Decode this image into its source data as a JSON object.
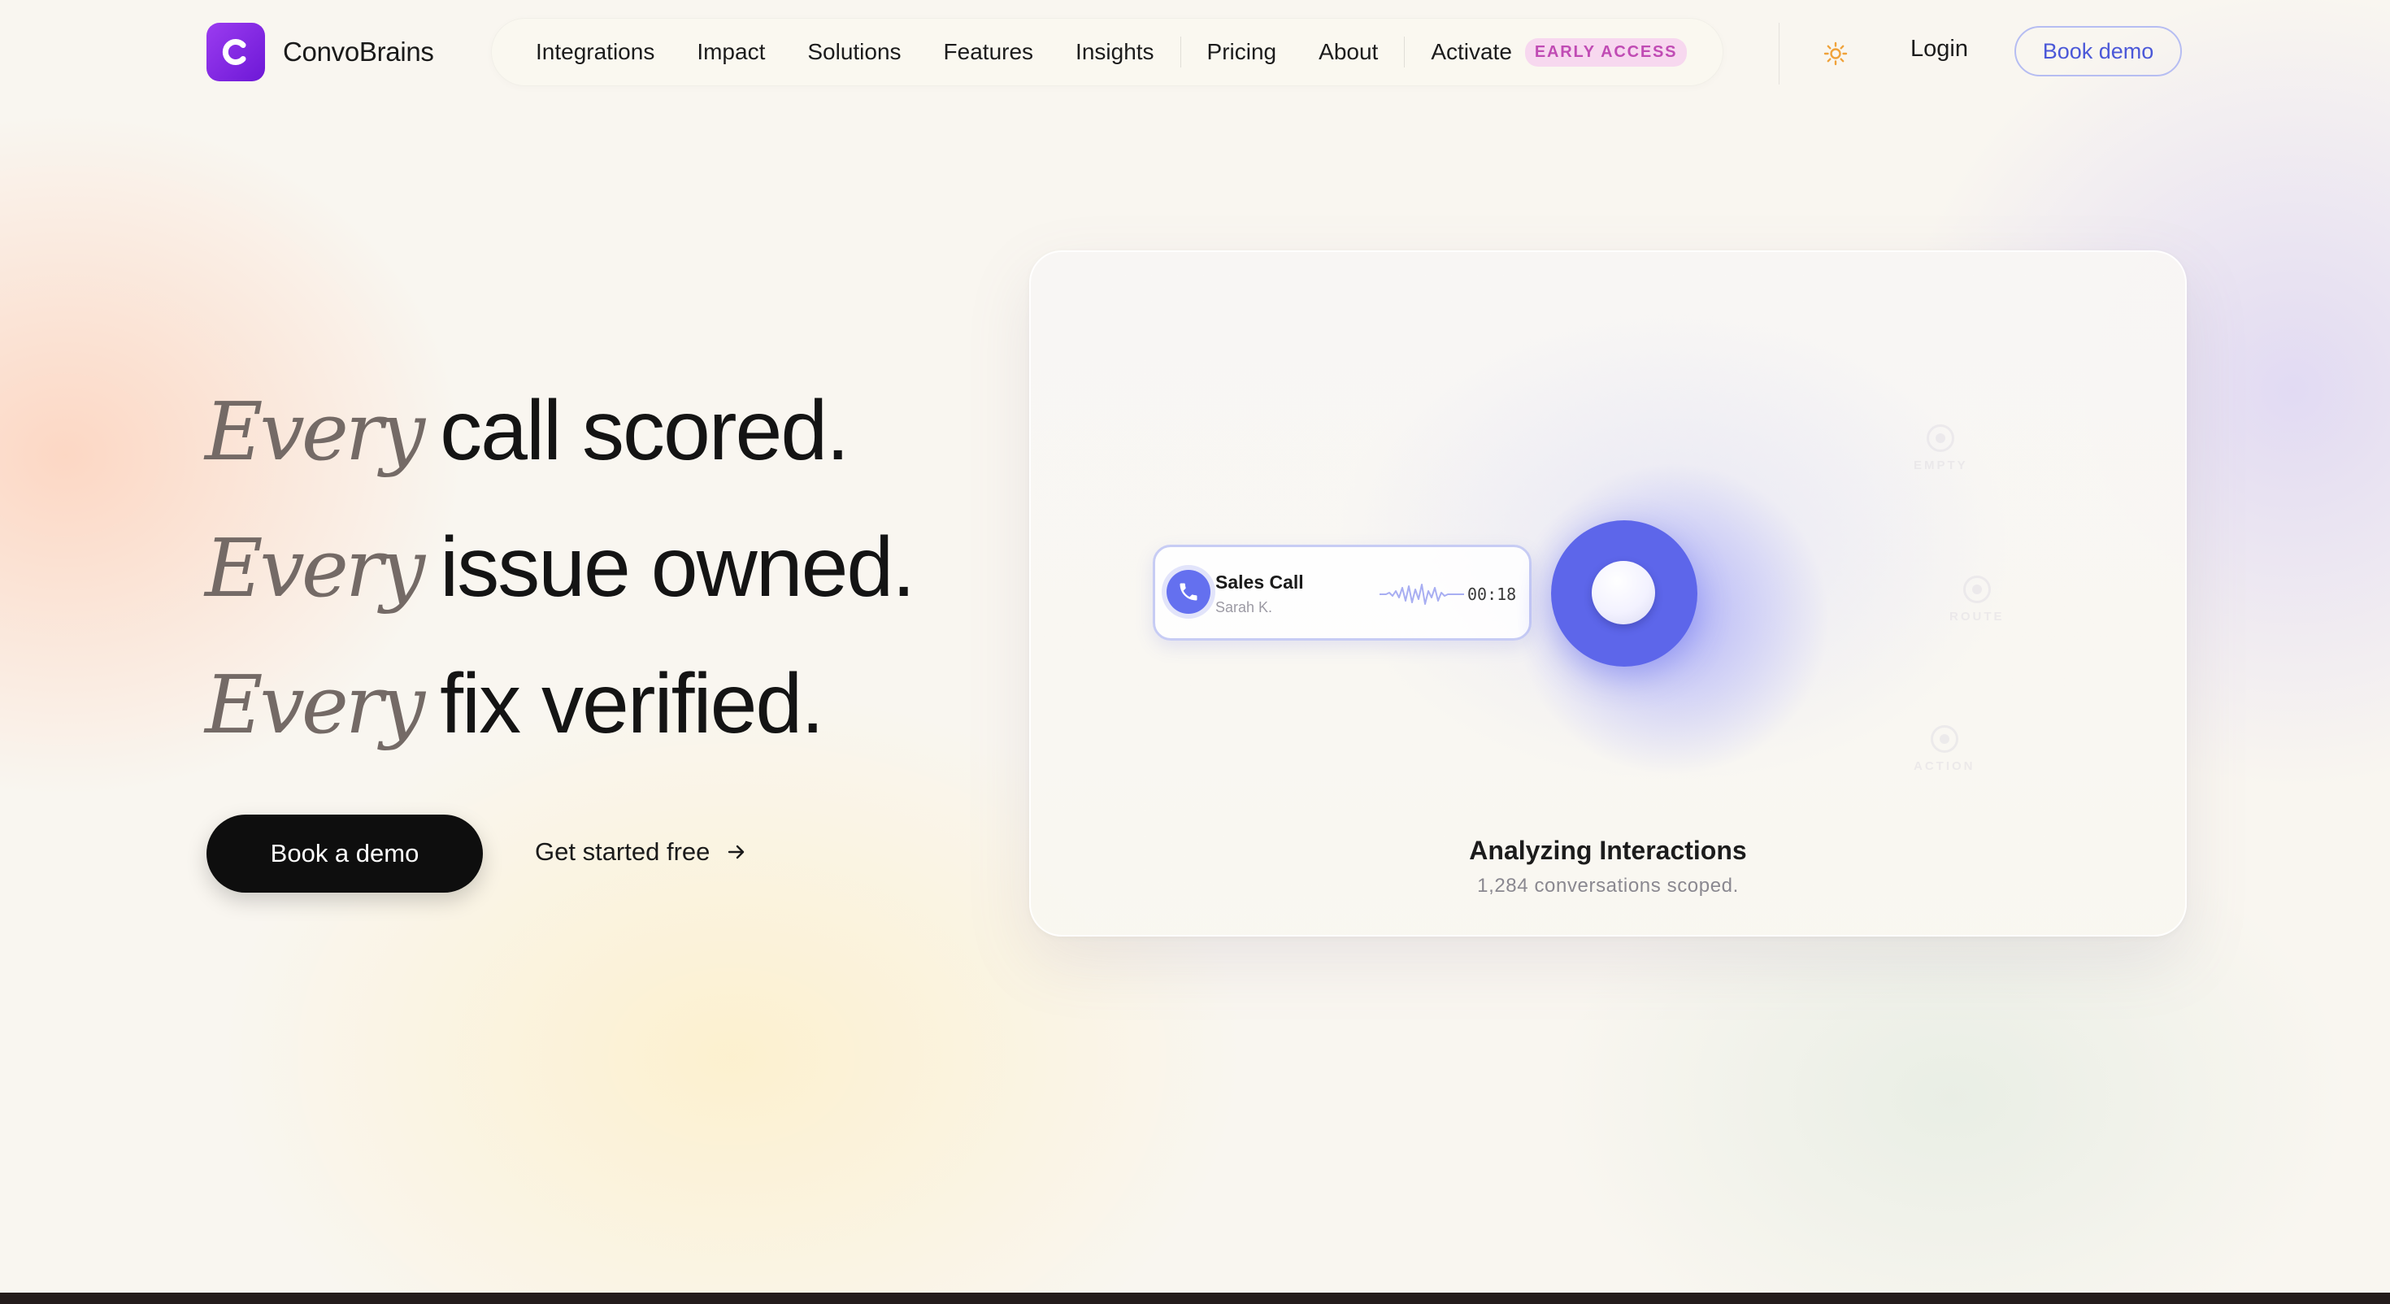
{
  "brand": {
    "name": "ConvoBrains",
    "accent": "#7a24e0"
  },
  "nav": {
    "items": [
      {
        "label": "Integrations"
      },
      {
        "label": "Impact"
      },
      {
        "label": "Solutions"
      },
      {
        "label": "Features"
      },
      {
        "label": "Insights"
      },
      {
        "label": "Pricing"
      },
      {
        "label": "About"
      },
      {
        "label": "Activate",
        "badge": "EARLY ACCESS"
      }
    ],
    "theme_icon": "sun-icon",
    "login_label": "Login",
    "book_demo_label": "Book demo"
  },
  "hero": {
    "lines": [
      {
        "italic": "Every",
        "rest": "call scored."
      },
      {
        "italic": "Every",
        "rest": "issue owned."
      },
      {
        "italic": "Every",
        "rest": "fix verified."
      }
    ],
    "primary_cta": "Book a demo",
    "secondary_cta": "Get started free",
    "secondary_icon": "arrow-right-icon"
  },
  "card": {
    "call": {
      "title": "Sales Call",
      "subtitle": "Sarah K.",
      "time": "00:18",
      "icon": "phone-icon"
    },
    "nodes": [
      {
        "label": "EMPTY"
      },
      {
        "label": "ROUTE"
      },
      {
        "label": "ACTION"
      }
    ],
    "title": "Analyzing Interactions",
    "subtitle": "1,284 conversations scoped.",
    "orb_color": "#5d66ea"
  }
}
